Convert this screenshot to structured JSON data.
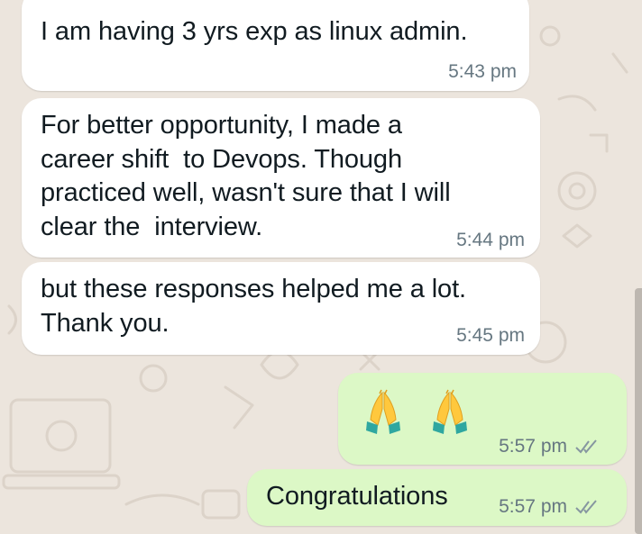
{
  "chat": {
    "messages": [
      {
        "direction": "incoming",
        "text": "I am having 3 yrs exp as linux admin.",
        "time": "5:43 pm"
      },
      {
        "direction": "incoming",
        "text": "For better opportunity, I made a\ncareer shift  to Devops. Though\npracticed well, wasn't sure that I will\nclear the  interview.",
        "time": "5:44 pm"
      },
      {
        "direction": "incoming",
        "text": "but these responses helped me a lot.\nThank you.",
        "time": "5:45 pm"
      },
      {
        "direction": "outgoing",
        "emojis": [
          "folded-hands",
          "folded-hands"
        ],
        "time": "5:57 pm",
        "status": "read-double-tick"
      },
      {
        "direction": "outgoing",
        "text": "Congratulations",
        "time": "5:57 pm",
        "status": "read-double-tick"
      }
    ]
  },
  "colors": {
    "background": "#ece5dd",
    "incoming_bubble": "#ffffff",
    "outgoing_bubble": "#dcf8c6",
    "timestamp": "#667781",
    "tick": "#8696a0"
  }
}
